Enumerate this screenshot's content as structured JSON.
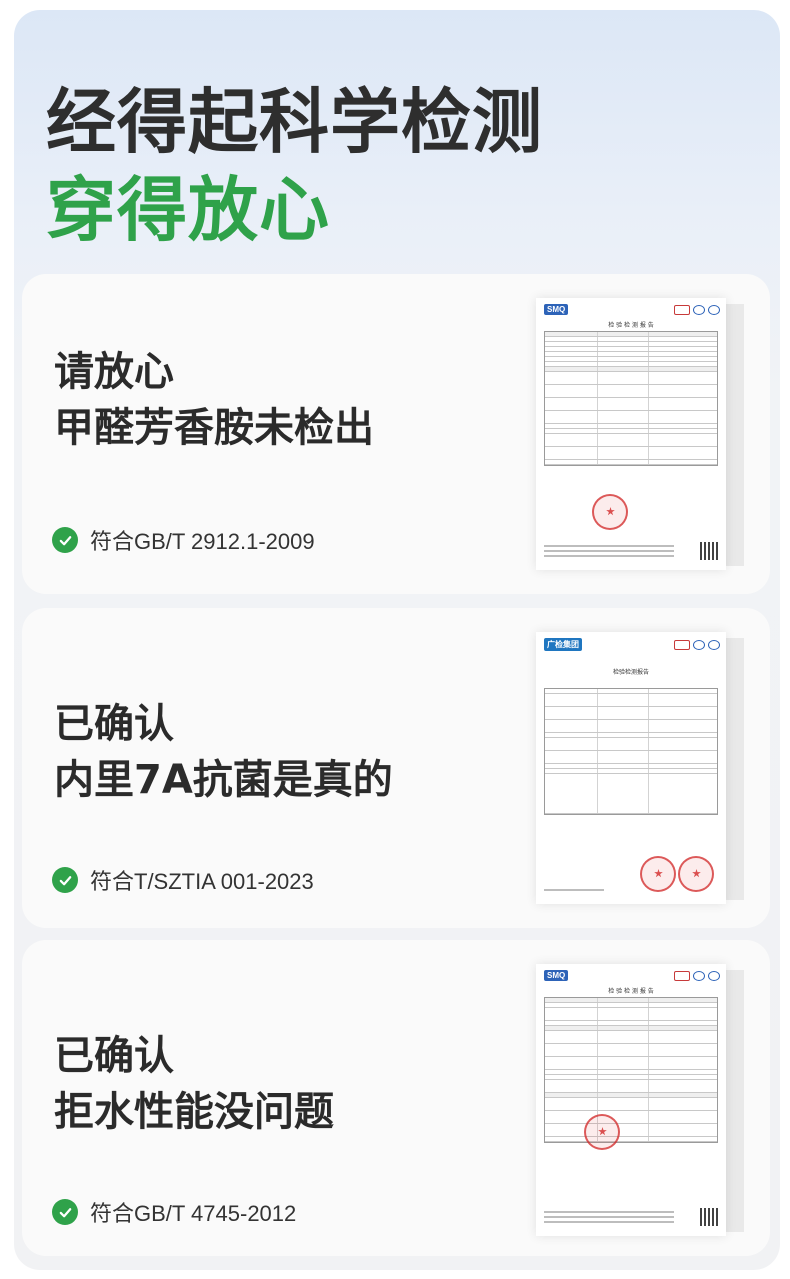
{
  "hero": {
    "line1": "经得起科学检测",
    "line2": "穿得放心",
    "accent_color": "#2fa24a"
  },
  "cards": [
    {
      "title_line1": "请放心",
      "title_line2": "甲醛芳香胺未检出",
      "standard": "符合GB/T 2912.1-2009",
      "report_logo": "SMQ",
      "report_title": "检 验 检 测 报 告"
    },
    {
      "title_line1": "已确认",
      "title_line2": "内里7A抗菌是真的",
      "standard": "符合T/SZTIA 001-2023",
      "report_logo": "广检集团",
      "report_title": "检验检测报告"
    },
    {
      "title_line1": "已确认",
      "title_line2": "拒水性能没问题",
      "standard": "符合GB/T 4745-2012",
      "report_logo": "SMQ",
      "report_title": "检 验 检 测 报 告"
    }
  ],
  "icons": {
    "check": "check-circle-icon"
  }
}
